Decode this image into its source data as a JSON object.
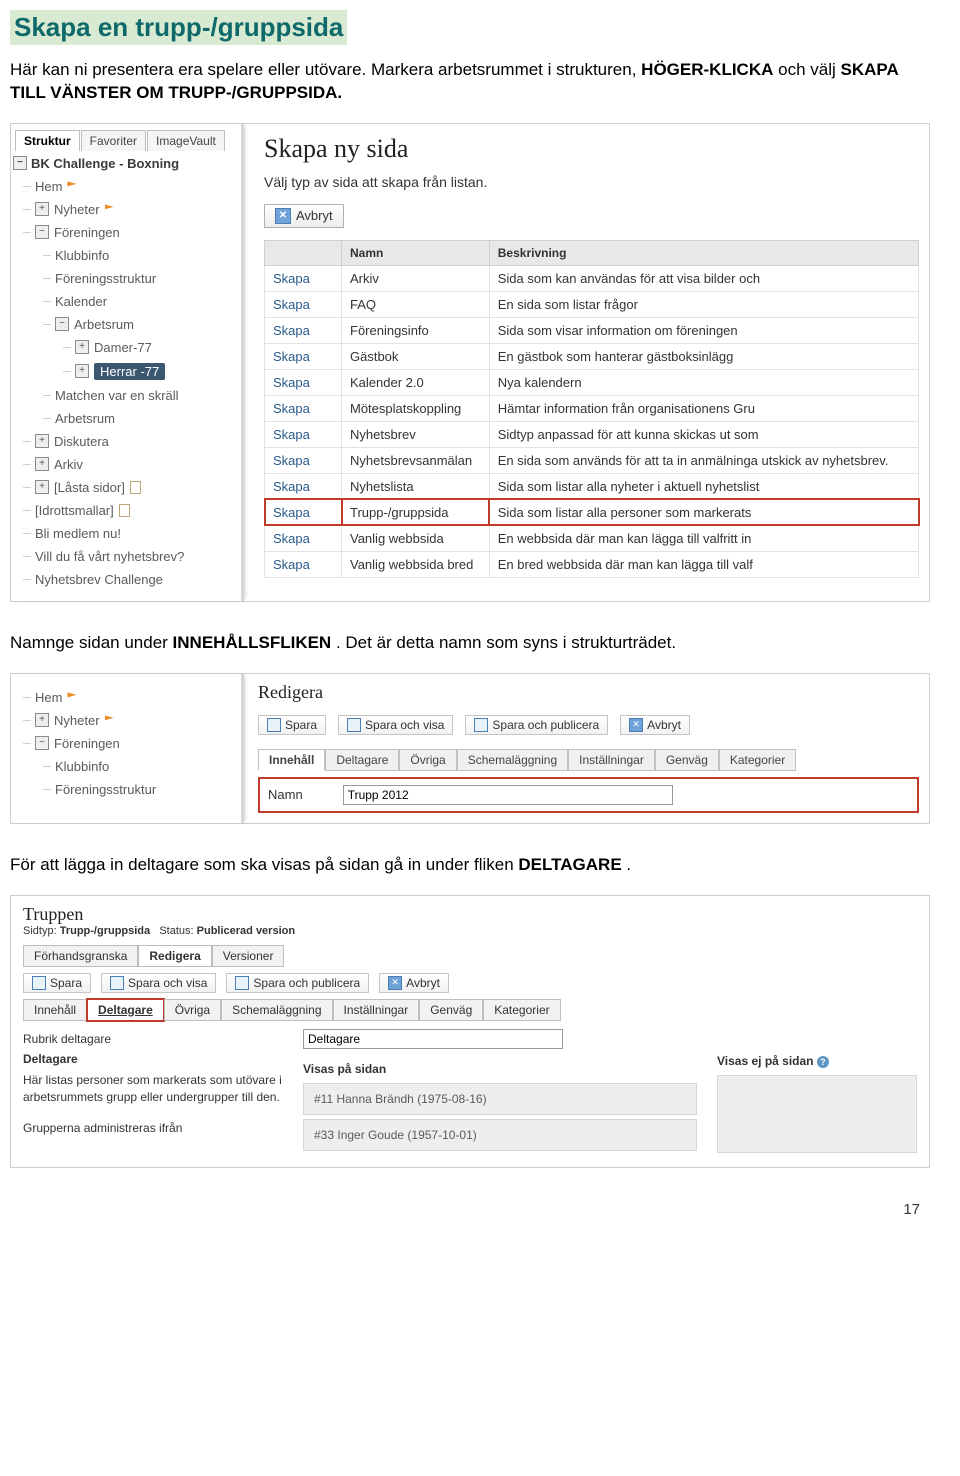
{
  "title": "Skapa en trupp-/gruppsida",
  "p1a": "Här kan ni presentera era spelare eller utövare. Markera arbetsrummet i strukturen, ",
  "p1b1": "HÖGER-KLICKA",
  "p1c": " och välj ",
  "p1b2": "SKAPA TILL VÄNSTER OM TRUPP-/GRUPPSIDA.",
  "p2a": "Namnge sidan under ",
  "p2b": "INNEHÅLLSFLIKEN",
  "p2c": ". Det är detta namn som syns i strukturträdet.",
  "p3a": "För att lägga in deltagare som ska visas på sidan gå in under fliken ",
  "p3b": "DELTAGARE",
  "p3c": ".",
  "page_number": "17",
  "shot1": {
    "tabs": [
      "Struktur",
      "Favoriter",
      "ImageVault"
    ],
    "root": "BK Challenge - Boxning",
    "tree": [
      {
        "l": 1,
        "ico": "",
        "label": "Hem",
        "flag": true
      },
      {
        "l": 1,
        "ico": "plus",
        "label": "Nyheter",
        "flag": true
      },
      {
        "l": 1,
        "ico": "minus",
        "label": "Föreningen"
      },
      {
        "l": 2,
        "ico": "",
        "label": "Klubbinfo"
      },
      {
        "l": 2,
        "ico": "",
        "label": "Föreningsstruktur"
      },
      {
        "l": 2,
        "ico": "",
        "label": "Kalender"
      },
      {
        "l": 2,
        "ico": "minus",
        "label": "Arbetsrum"
      },
      {
        "l": 3,
        "ico": "plus",
        "label": "Damer-77"
      },
      {
        "l": 3,
        "ico": "plus",
        "label": "Herrar -77",
        "sel": true
      },
      {
        "l": 2,
        "ico": "",
        "label": "Matchen var en skräll"
      },
      {
        "l": 2,
        "ico": "",
        "label": "Arbetsrum"
      },
      {
        "l": 1,
        "ico": "plus",
        "label": "Diskutera"
      },
      {
        "l": 1,
        "ico": "plus",
        "label": "Arkiv"
      },
      {
        "l": 1,
        "ico": "plus",
        "label": "[Låsta sidor]",
        "doc": true
      },
      {
        "l": 1,
        "ico": "",
        "label": "[Idrottsmallar]",
        "doc": true
      },
      {
        "l": 1,
        "ico": "",
        "label": "Bli medlem nu!"
      },
      {
        "l": 1,
        "ico": "",
        "label": "Vill du få vårt nyhetsbrev?"
      },
      {
        "l": 1,
        "ico": "",
        "label": "Nyhetsbrev Challenge"
      }
    ],
    "right": {
      "heading": "Skapa ny sida",
      "sub": "Välj typ av sida att skapa från listan.",
      "avbryt": "Avbryt",
      "cols": {
        "skapa": "",
        "namn": "Namn",
        "besk": "Beskrivning"
      },
      "rows": [
        {
          "s": "Skapa",
          "n": "Arkiv",
          "b": "Sida som kan användas för att visa bilder och"
        },
        {
          "s": "Skapa",
          "n": "FAQ",
          "b": "En sida som listar frågor"
        },
        {
          "s": "Skapa",
          "n": "Föreningsinfo",
          "b": "Sida som visar information om föreningen"
        },
        {
          "s": "Skapa",
          "n": "Gästbok",
          "b": "En gästbok som hanterar gästboksinlägg"
        },
        {
          "s": "Skapa",
          "n": "Kalender 2.0",
          "b": "Nya kalendern"
        },
        {
          "s": "Skapa",
          "n": "Mötesplatskoppling",
          "b": "Hämtar information från organisationens Gru"
        },
        {
          "s": "Skapa",
          "n": "Nyhetsbrev",
          "b": "Sidtyp anpassad för att kunna skickas ut som"
        },
        {
          "s": "Skapa",
          "n": "Nyhetsbrevsanmälan",
          "b": "En sida som används för att ta in anmälninga utskick av nyhetsbrev."
        },
        {
          "s": "Skapa",
          "n": "Nyhetslista",
          "b": "Sida som listar alla nyheter i aktuell nyhetslist"
        },
        {
          "s": "Skapa",
          "n": "Trupp-/gruppsida",
          "b": "Sida som listar alla personer som markerats",
          "hl": true
        },
        {
          "s": "Skapa",
          "n": "Vanlig webbsida",
          "b": "En webbsida där man kan lägga till valfritt in"
        },
        {
          "s": "Skapa",
          "n": "Vanlig webbsida bred",
          "b": "En bred webbsida där man kan lägga till valf"
        }
      ]
    }
  },
  "shot2": {
    "tree": [
      {
        "l": 1,
        "ico": "",
        "label": "Hem",
        "flag": true
      },
      {
        "l": 1,
        "ico": "plus",
        "label": "Nyheter",
        "flag": true
      },
      {
        "l": 1,
        "ico": "minus",
        "label": "Föreningen"
      },
      {
        "l": 2,
        "ico": "",
        "label": "Klubbinfo"
      },
      {
        "l": 2,
        "ico": "",
        "label": "Föreningsstruktur"
      }
    ],
    "right": {
      "heading": "Redigera",
      "buttons": [
        "Spara",
        "Spara och visa",
        "Spara och publicera",
        "Avbryt"
      ],
      "tabs": [
        "Innehåll",
        "Deltagare",
        "Övriga",
        "Schemaläggning",
        "Inställningar",
        "Genväg",
        "Kategorier"
      ],
      "field_label": "Namn",
      "field_value": "Trupp 2012"
    }
  },
  "shot3": {
    "truppen": "Truppen",
    "sidtyp_label": "Sidtyp:",
    "sidtyp_value": "Trupp-/gruppsida",
    "status_label": "Status:",
    "status_value": "Publicerad version",
    "tabs_top": [
      "Förhandsgranska",
      "Redigera",
      "Versioner"
    ],
    "buttons": [
      "Spara",
      "Spara och visa",
      "Spara och publicera",
      "Avbryt"
    ],
    "tabs_bot": [
      "Innehåll",
      "Deltagare",
      "Övriga",
      "Schemaläggning",
      "Inställningar",
      "Genväg",
      "Kategorier"
    ],
    "rubrik_label": "Rubrik deltagare",
    "rubrik_value": "Deltagare",
    "col1_heading": "Deltagare",
    "col1_text": "Här listas personer som markerats som utövare i arbetsrummets grupp eller undergrupper till den.",
    "col1_text2": "Grupperna administreras ifrån",
    "col2_heading": "Visas på sidan",
    "col2_items": [
      "#11 Hanna Brändh (1975-08-16)",
      "#33 Inger Goude (1957-10-01)"
    ],
    "col3_heading": "Visas ej på sidan"
  }
}
